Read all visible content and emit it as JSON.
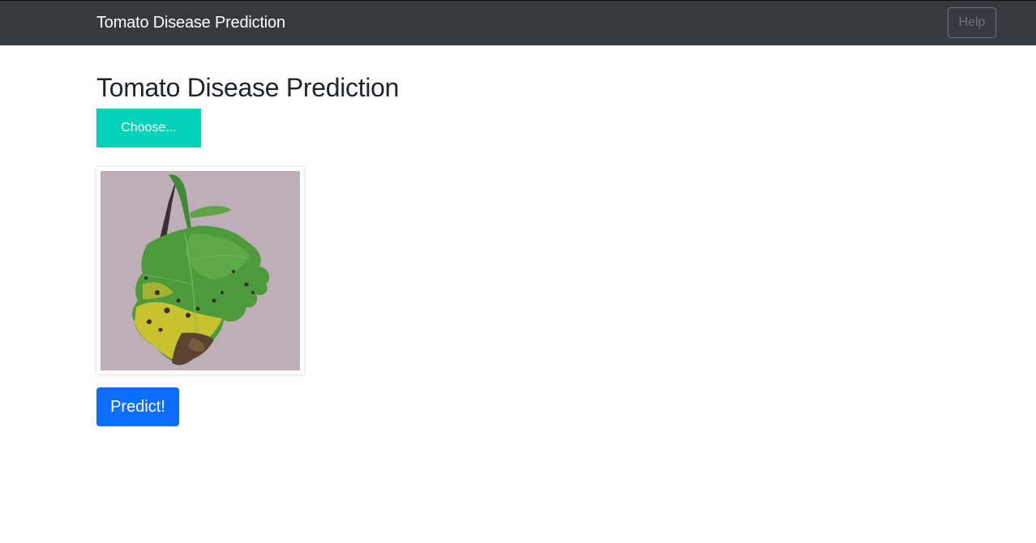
{
  "navbar": {
    "brand": "Tomato Disease Prediction",
    "help_label": "Help"
  },
  "main": {
    "title": "Tomato Disease Prediction",
    "choose_label": "Choose...",
    "predict_label": "Predict!",
    "preview_image": "tomato-leaf-image"
  },
  "colors": {
    "navbar_bg": "#343a40",
    "choose_bg": "#00d3b8",
    "predict_bg": "#0d6efd",
    "help_border": "#6c757d"
  }
}
